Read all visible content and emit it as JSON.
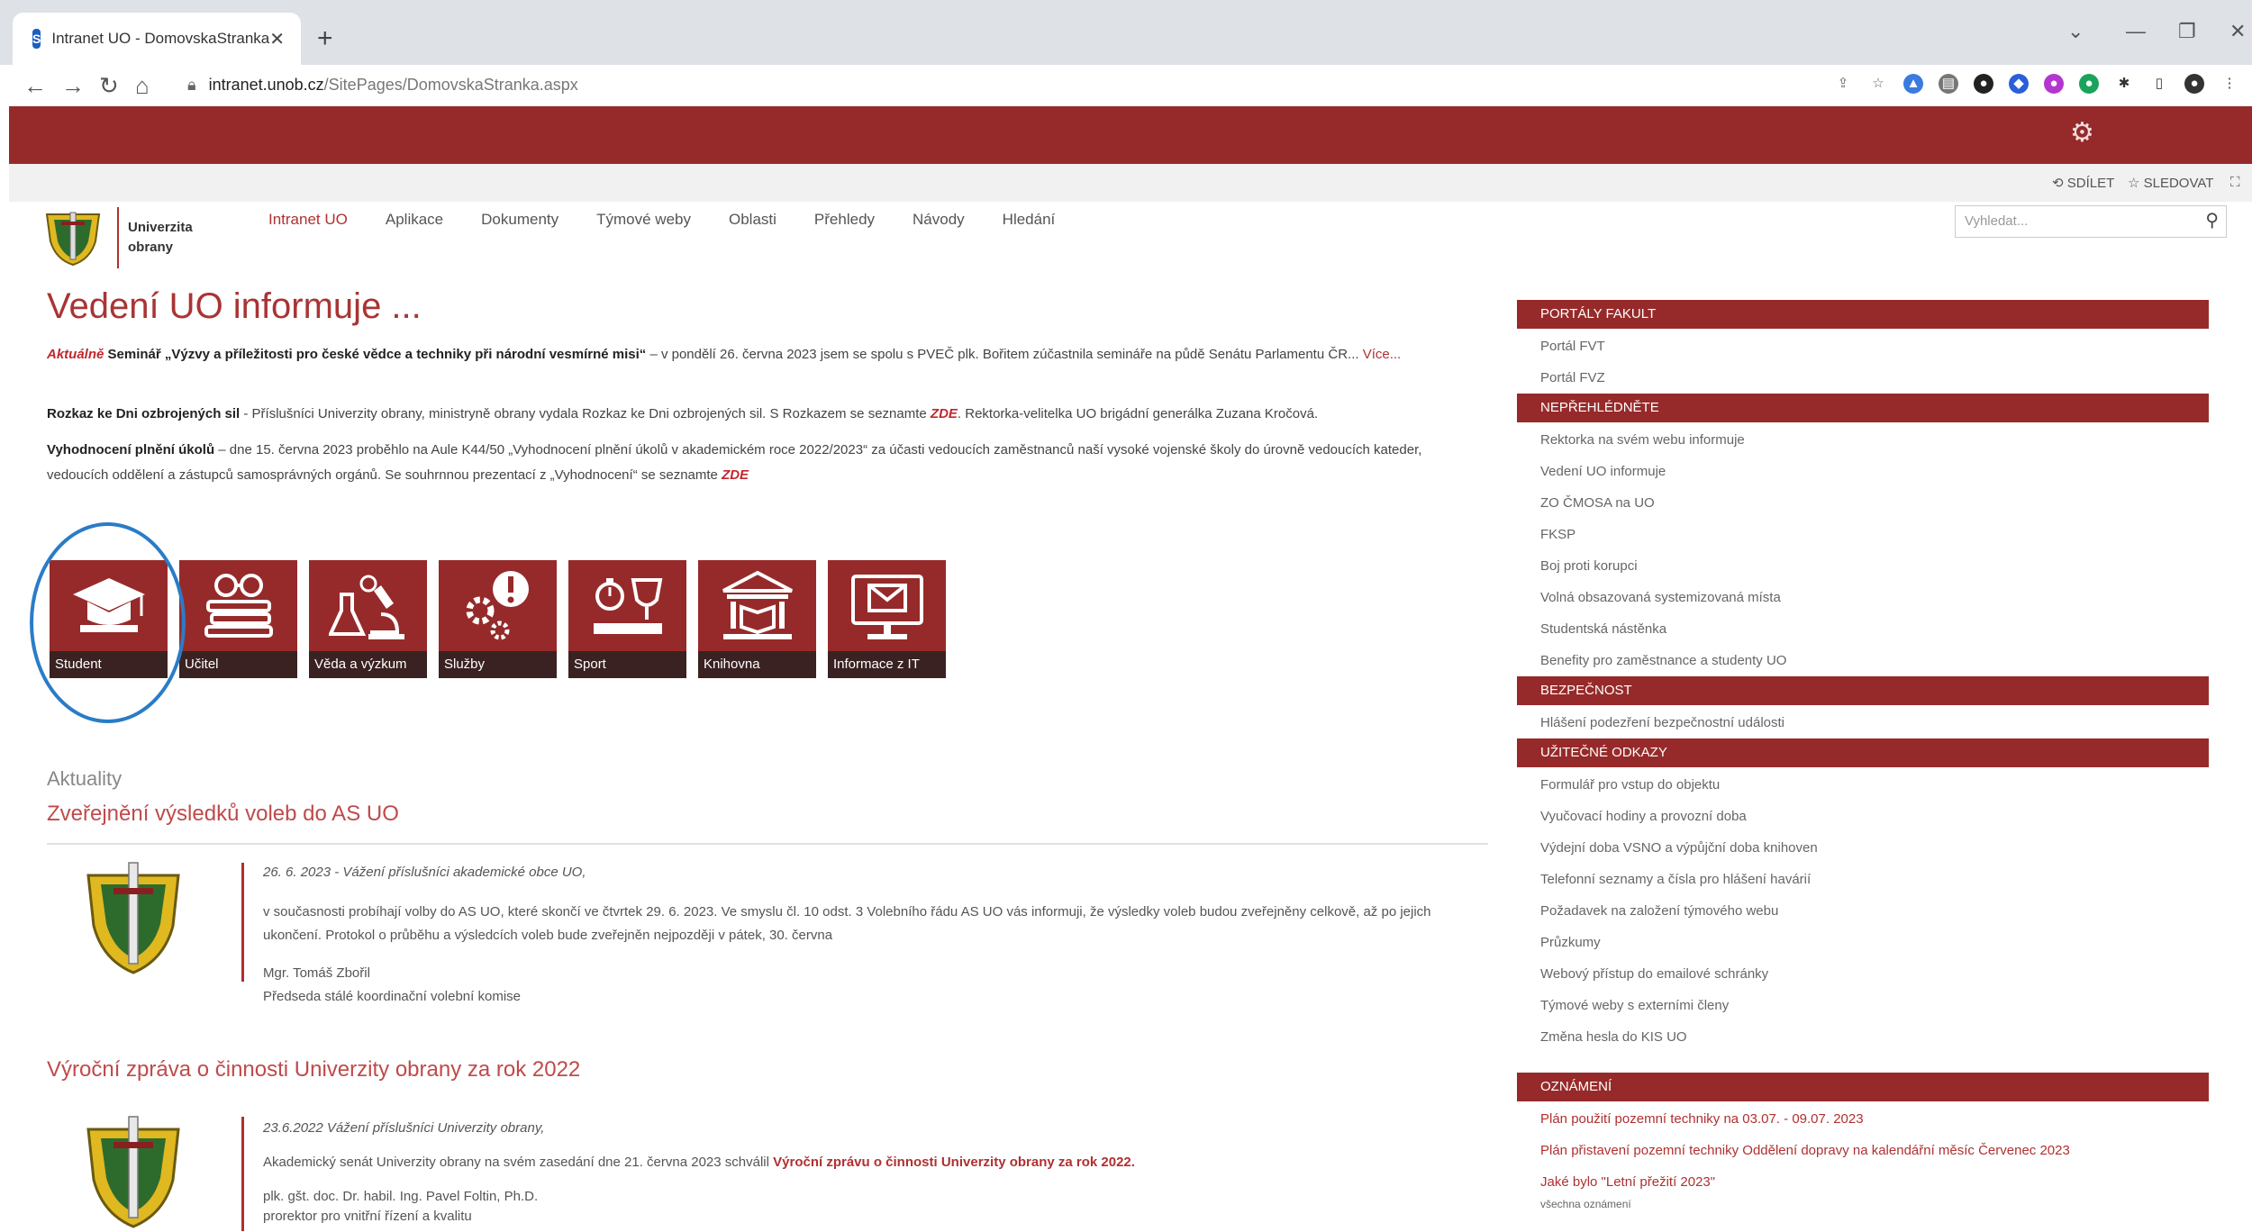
{
  "browser": {
    "tab_title": "Intranet UO - DomovskaStranka",
    "url_host": "intranet.unob.cz",
    "url_path": "/SitePages/DomovskaStranka.aspx"
  },
  "subbar": {
    "share": "SDÍLET",
    "follow": "SLEDOVAT"
  },
  "org": {
    "name_line1": "Univerzita",
    "name_line2": "obrany"
  },
  "nav": [
    "Intranet UO",
    "Aplikace",
    "Dokumenty",
    "Týmové weby",
    "Oblasti",
    "Přehledy",
    "Návody",
    "Hledání"
  ],
  "search": {
    "placeholder": "Vyhledat..."
  },
  "page_title": "Vedení UO informuje ...",
  "news": {
    "n1_label": "Aktuálně",
    "n1_bold": " Seminář „Výzvy a příležitosti pro české vědce a techniky při národní vesmírné misi“",
    "n1_text": " – v pondělí 26. června 2023 jsem se spolu s PVEČ plk. Bořitem zúčastnila semináře na půdě Senátu Parlamentu ČR...",
    "n1_more": "Více...",
    "n2_bold": "Rozkaz ke Dni ozbrojených sil",
    "n2_text": " - Příslušníci Univerzity obrany, ministryně obrany vydala Rozkaz ke Dni ozbrojených sil. S Rozkazem se seznamte ",
    "n2_zde": "ZDE",
    "n2_text2": ". Rektorka-velitelka UO brigádní generálka Zuzana Kročová.",
    "n3_bold": "Vyhodnocení plnění úkolů",
    "n3_text": " – dne 15. června 2023 proběhlo na Aule K44/50 „Vyhodnocení plnění úkolů v akademickém roce 2022/2023“ za účasti vedoucích zaměstnanců naší vysoké vojenské školy do úrovně vedoucích kateder, vedoucích oddělení a zástupců samosprávných orgánů. Se souhrnnou prezentací z „Vyhodnocení“ se seznamte ",
    "n3_zde": "ZDE"
  },
  "tiles": [
    "Student",
    "Učitel",
    "Věda a výzkum",
    "Služby",
    "Sport",
    "Knihovna",
    "Informace z IT"
  ],
  "aktuality": {
    "label": "Aktuality",
    "a1_title": "Zveřejnění výsledků voleb do AS UO",
    "a1_header": "26. 6. 2023 - Vážení příslušníci akademické obce UO,",
    "a1_body": "v současnosti probíhají volby do AS UO, které skončí ve čtvrtek 29. 6. 2023. Ve smyslu čl. 10 odst. 3 Volebního řádu AS UO vás informuji, že výsledky voleb budou zveřejněny celkově, až po jejich ukončení. Protokol o průběhu a výsledcích voleb bude zveřejněn nejpozději v pátek, 30. června",
    "a1_sign1": "Mgr. Tomáš Zbořil",
    "a1_sign2": "Předseda stálé koordinační volební komise",
    "a2_title": "Výroční zpráva o činnosti Univerzity obrany za rok 2022",
    "a2_header": "23.6.2022 Vážení příslušníci Univerzity obrany,",
    "a2_body": "Akademický senát Univerzity obrany na svém zasedání dne 21. června 2023 schválil ",
    "a2_body_bold": "Výroční zprávu o činnosti Univerzity obrany za rok 2022.",
    "a2_sign1": "plk. gšt. doc. Dr. habil. Ing. Pavel Foltin, Ph.D.",
    "a2_sign2": "prorektor pro vnitřní řízení a kvalitu"
  },
  "sidebar": {
    "portaly": {
      "title": "PORTÁLY FAKULT",
      "items": [
        "Portál FVT",
        "Portál FVZ"
      ]
    },
    "neprehlednete": {
      "title": "NEPŘEHLÉDNĚTE",
      "items": [
        "Rektorka na svém webu informuje",
        "Vedení UO informuje",
        "ZO ČMOSA na UO",
        "FKSP",
        "Boj proti korupci",
        "Volná obsazovaná systemizovaná místa",
        "Studentská nástěnka",
        "Benefity pro zaměstnance a studenty UO"
      ]
    },
    "bezpecnost": {
      "title": "BEZPEČNOST",
      "items": [
        "Hlášení podezření bezpečnostní události"
      ]
    },
    "odkazy": {
      "title": "UŽITEČNÉ ODKAZY",
      "items": [
        "Formulář pro vstup do objektu",
        "Vyučovací hodiny a provozní doba",
        "Výdejní doba VSNO a výpůjční doba knihoven",
        "Telefonní seznamy a čísla pro hlášení havárií",
        "Požadavek na založení týmového webu",
        "Průzkumy",
        "Webový přístup do emailové schránky",
        "Týmové weby s externími členy",
        "Změna hesla do KIS UO"
      ]
    },
    "oznameni": {
      "title": "OZNÁMENÍ",
      "items": [
        "Plán použití pozemní techniky na 03.07. - 09.07. 2023",
        "Plán přistavení pozemní techniky Oddělení dopravy na kalendářní měsíc Červenec 2023",
        "Jaké bylo \"Letní přežití 2023\""
      ],
      "all": "všechna oznámení"
    }
  },
  "colors": {
    "brand": "#962a2a",
    "accent": "#b03030",
    "highlight_circle": "#2a7cc7"
  },
  "icons": [
    "graduation-cap-icon",
    "books-glasses-icon",
    "lab-icon",
    "gears-exclamation-icon",
    "trophy-icon",
    "library-building-icon",
    "monitor-mail-icon"
  ]
}
